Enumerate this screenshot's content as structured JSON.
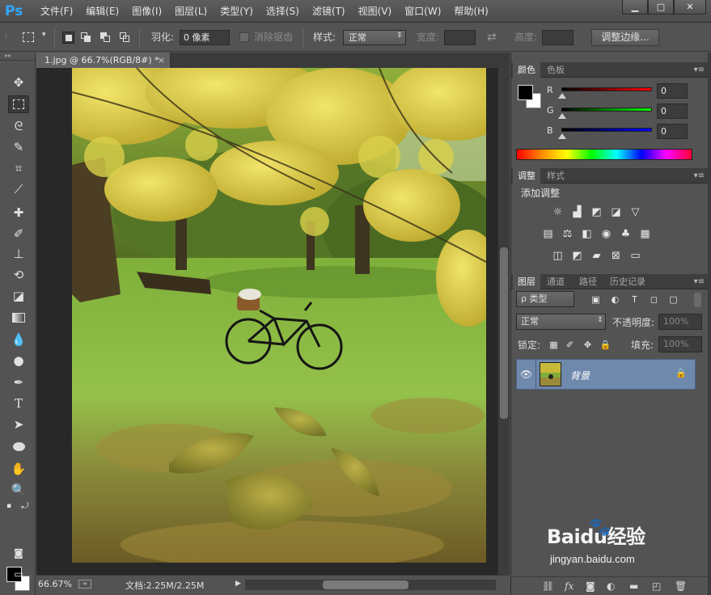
{
  "app": {
    "logo": "Ps"
  },
  "menu": [
    "文件(F)",
    "编辑(E)",
    "图像(I)",
    "图层(L)",
    "类型(Y)",
    "选择(S)",
    "滤镜(T)",
    "视图(V)",
    "窗口(W)",
    "帮助(H)"
  ],
  "window_controls": {
    "minimize": "▁",
    "maximize": "□",
    "close": "✕"
  },
  "options_bar": {
    "feather_label": "羽化:",
    "feather_value": "0 像素",
    "antialias_label": "消除锯齿",
    "style_label": "样式:",
    "style_value": "正常",
    "width_label": "宽度:",
    "height_label": "高度:",
    "refine_edge_button": "调整边缘..."
  },
  "document": {
    "tab_title": "1.jpg @ 66.7%(RGB/8#) *",
    "close": "×"
  },
  "status": {
    "zoom": "66.67%",
    "doc_size": "文档:2.25M/2.25M"
  },
  "color_panel": {
    "tabs": [
      "颜色",
      "色板"
    ],
    "channels": [
      {
        "label": "R",
        "value": "0",
        "color": "#ff0000"
      },
      {
        "label": "G",
        "value": "0",
        "color": "#00ff00"
      },
      {
        "label": "B",
        "value": "0",
        "color": "#0000ff"
      }
    ]
  },
  "adjustments_panel": {
    "tabs": [
      "调整",
      "样式"
    ],
    "title": "添加调整"
  },
  "layers_panel": {
    "tabs": [
      "图层",
      "通道",
      "路径",
      "历史记录"
    ],
    "filter_label": "ρ 类型",
    "blend_mode": "正常",
    "opacity_label": "不透明度:",
    "opacity_value": "100%",
    "lock_label": "锁定:",
    "fill_label": "填充:",
    "fill_value": "100%",
    "layers": [
      {
        "name": "背景",
        "visible": true,
        "locked": true
      }
    ]
  },
  "watermark": {
    "text": "Baidu经验",
    "url": "jingyan.baidu.com"
  },
  "colors": {
    "foreground": "#000000",
    "background": "#ffffff",
    "selected_layer": "#6f89ad",
    "ps_blue": "#31a8ff"
  }
}
